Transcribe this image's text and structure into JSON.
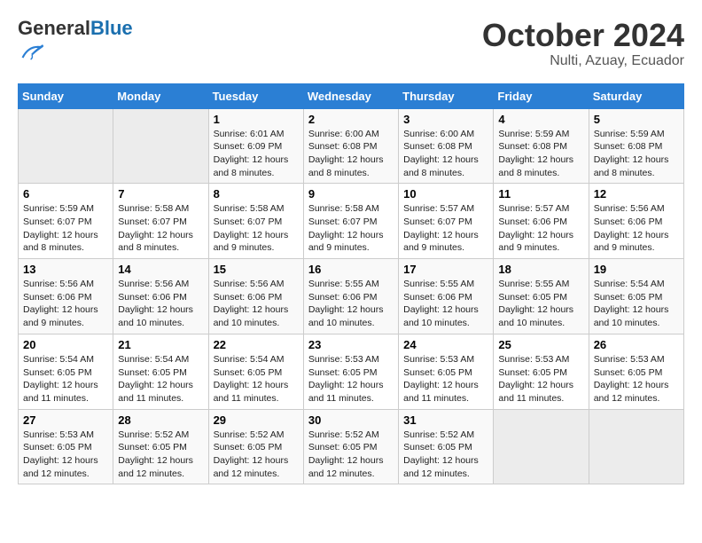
{
  "header": {
    "logo_general": "General",
    "logo_blue": "Blue",
    "month_year": "October 2024",
    "location": "Nulti, Azuay, Ecuador"
  },
  "days_of_week": [
    "Sunday",
    "Monday",
    "Tuesday",
    "Wednesday",
    "Thursday",
    "Friday",
    "Saturday"
  ],
  "weeks": [
    [
      {
        "num": "",
        "info": ""
      },
      {
        "num": "",
        "info": ""
      },
      {
        "num": "1",
        "info": "Sunrise: 6:01 AM\nSunset: 6:09 PM\nDaylight: 12 hours and 8 minutes."
      },
      {
        "num": "2",
        "info": "Sunrise: 6:00 AM\nSunset: 6:08 PM\nDaylight: 12 hours and 8 minutes."
      },
      {
        "num": "3",
        "info": "Sunrise: 6:00 AM\nSunset: 6:08 PM\nDaylight: 12 hours and 8 minutes."
      },
      {
        "num": "4",
        "info": "Sunrise: 5:59 AM\nSunset: 6:08 PM\nDaylight: 12 hours and 8 minutes."
      },
      {
        "num": "5",
        "info": "Sunrise: 5:59 AM\nSunset: 6:08 PM\nDaylight: 12 hours and 8 minutes."
      }
    ],
    [
      {
        "num": "6",
        "info": "Sunrise: 5:59 AM\nSunset: 6:07 PM\nDaylight: 12 hours and 8 minutes."
      },
      {
        "num": "7",
        "info": "Sunrise: 5:58 AM\nSunset: 6:07 PM\nDaylight: 12 hours and 8 minutes."
      },
      {
        "num": "8",
        "info": "Sunrise: 5:58 AM\nSunset: 6:07 PM\nDaylight: 12 hours and 9 minutes."
      },
      {
        "num": "9",
        "info": "Sunrise: 5:58 AM\nSunset: 6:07 PM\nDaylight: 12 hours and 9 minutes."
      },
      {
        "num": "10",
        "info": "Sunrise: 5:57 AM\nSunset: 6:07 PM\nDaylight: 12 hours and 9 minutes."
      },
      {
        "num": "11",
        "info": "Sunrise: 5:57 AM\nSunset: 6:06 PM\nDaylight: 12 hours and 9 minutes."
      },
      {
        "num": "12",
        "info": "Sunrise: 5:56 AM\nSunset: 6:06 PM\nDaylight: 12 hours and 9 minutes."
      }
    ],
    [
      {
        "num": "13",
        "info": "Sunrise: 5:56 AM\nSunset: 6:06 PM\nDaylight: 12 hours and 9 minutes."
      },
      {
        "num": "14",
        "info": "Sunrise: 5:56 AM\nSunset: 6:06 PM\nDaylight: 12 hours and 10 minutes."
      },
      {
        "num": "15",
        "info": "Sunrise: 5:56 AM\nSunset: 6:06 PM\nDaylight: 12 hours and 10 minutes."
      },
      {
        "num": "16",
        "info": "Sunrise: 5:55 AM\nSunset: 6:06 PM\nDaylight: 12 hours and 10 minutes."
      },
      {
        "num": "17",
        "info": "Sunrise: 5:55 AM\nSunset: 6:06 PM\nDaylight: 12 hours and 10 minutes."
      },
      {
        "num": "18",
        "info": "Sunrise: 5:55 AM\nSunset: 6:05 PM\nDaylight: 12 hours and 10 minutes."
      },
      {
        "num": "19",
        "info": "Sunrise: 5:54 AM\nSunset: 6:05 PM\nDaylight: 12 hours and 10 minutes."
      }
    ],
    [
      {
        "num": "20",
        "info": "Sunrise: 5:54 AM\nSunset: 6:05 PM\nDaylight: 12 hours and 11 minutes."
      },
      {
        "num": "21",
        "info": "Sunrise: 5:54 AM\nSunset: 6:05 PM\nDaylight: 12 hours and 11 minutes."
      },
      {
        "num": "22",
        "info": "Sunrise: 5:54 AM\nSunset: 6:05 PM\nDaylight: 12 hours and 11 minutes."
      },
      {
        "num": "23",
        "info": "Sunrise: 5:53 AM\nSunset: 6:05 PM\nDaylight: 12 hours and 11 minutes."
      },
      {
        "num": "24",
        "info": "Sunrise: 5:53 AM\nSunset: 6:05 PM\nDaylight: 12 hours and 11 minutes."
      },
      {
        "num": "25",
        "info": "Sunrise: 5:53 AM\nSunset: 6:05 PM\nDaylight: 12 hours and 11 minutes."
      },
      {
        "num": "26",
        "info": "Sunrise: 5:53 AM\nSunset: 6:05 PM\nDaylight: 12 hours and 12 minutes."
      }
    ],
    [
      {
        "num": "27",
        "info": "Sunrise: 5:53 AM\nSunset: 6:05 PM\nDaylight: 12 hours and 12 minutes."
      },
      {
        "num": "28",
        "info": "Sunrise: 5:52 AM\nSunset: 6:05 PM\nDaylight: 12 hours and 12 minutes."
      },
      {
        "num": "29",
        "info": "Sunrise: 5:52 AM\nSunset: 6:05 PM\nDaylight: 12 hours and 12 minutes."
      },
      {
        "num": "30",
        "info": "Sunrise: 5:52 AM\nSunset: 6:05 PM\nDaylight: 12 hours and 12 minutes."
      },
      {
        "num": "31",
        "info": "Sunrise: 5:52 AM\nSunset: 6:05 PM\nDaylight: 12 hours and 12 minutes."
      },
      {
        "num": "",
        "info": ""
      },
      {
        "num": "",
        "info": ""
      }
    ]
  ]
}
